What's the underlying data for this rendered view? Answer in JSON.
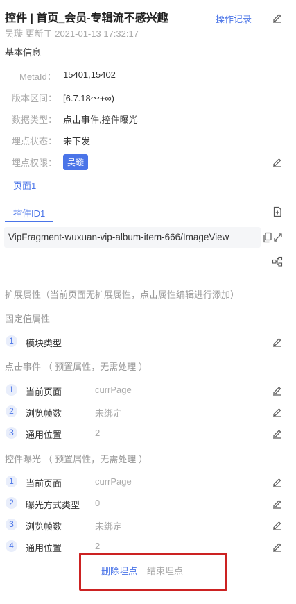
{
  "header": {
    "title": "控件 | 首页_会员-专辑流不感兴趣",
    "subtitle": "吴璇 更新于 2021-01-13 17:32:17",
    "oplog_label": "操作记录"
  },
  "basic": {
    "section_title": "基本信息",
    "metaid_label": "MetaId：",
    "metaid_value": "15401,15402",
    "version_label": "版本区间：",
    "version_value": "[6.7.18～+∞)",
    "datatype_label": "数据类型：",
    "datatype_value": "点击事件,控件曝光",
    "status_label": "埋点状态：",
    "status_value": "未下发",
    "permission_label": "埋点权限：",
    "permission_value": "吴璇"
  },
  "page_tab": "页面1",
  "control": {
    "tab": "控件ID1",
    "id_value": "VipFragment-wuxuan-vip-album-item-666/ImageView"
  },
  "ext_attr": "扩展属性（当前页面无扩展属性，点击属性编辑进行添加）",
  "fixed": {
    "title": "固定值属性",
    "items": [
      {
        "num": "1",
        "name": "模块类型",
        "value": ""
      }
    ]
  },
  "click": {
    "title": "点击事件  （ 预置属性，无需处理 ）",
    "items": [
      {
        "num": "1",
        "name": "当前页面",
        "value": "currPage"
      },
      {
        "num": "2",
        "name": "浏览帧数",
        "value": "未绑定"
      },
      {
        "num": "3",
        "name": "通用位置",
        "value": "2"
      }
    ]
  },
  "expose": {
    "title": "控件曝光  （ 预置属性，无需处理 ）",
    "items": [
      {
        "num": "1",
        "name": "当前页面",
        "value": "currPage"
      },
      {
        "num": "2",
        "name": "曝光方式类型",
        "value": "0"
      },
      {
        "num": "3",
        "name": "浏览帧数",
        "value": "未绑定"
      },
      {
        "num": "4",
        "name": "通用位置",
        "value": "2"
      }
    ]
  },
  "actions": {
    "delete_label": "删除埋点",
    "end_label": "结束埋点"
  },
  "colors": {
    "accent": "#4a74e8",
    "highlight_box": "#cc2222"
  }
}
